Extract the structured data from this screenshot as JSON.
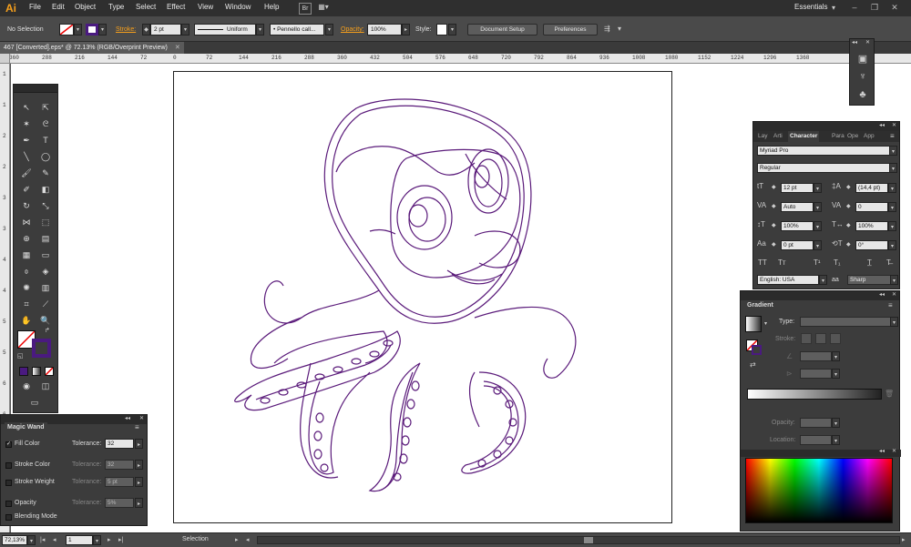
{
  "app": {
    "logo": "Ai",
    "workspace": "Essentials"
  },
  "menu": [
    "File",
    "Edit",
    "Object",
    "Type",
    "Select",
    "Effect",
    "View",
    "Window",
    "Help"
  ],
  "control_bar": {
    "selection": "No Selection",
    "stroke_label": "Stroke:",
    "stroke_weight": "2 pt",
    "profile": "Uniform",
    "brush": "Pennello call...",
    "opacity_label": "Opacity:",
    "opacity": "100%",
    "style_label": "Style:",
    "document_setup": "Document Setup",
    "preferences": "Preferences"
  },
  "document": {
    "tab": "467 [Converted].eps* @ 72.13% (RGB/Overprint Preview)"
  },
  "ruler": {
    "h_ticks": [
      "360",
      "288",
      "216",
      "144",
      "72",
      "0",
      "72",
      "144",
      "216",
      "288",
      "360",
      "432",
      "504",
      "576",
      "648",
      "720",
      "792",
      "864",
      "936",
      "1008",
      "1080",
      "1152",
      "1224",
      "1296",
      "1368"
    ],
    "v_ticks": [
      "1",
      "1",
      "2",
      "2",
      "3",
      "3",
      "4",
      "4",
      "5",
      "5",
      "6",
      "6",
      "7",
      "7",
      "8"
    ]
  },
  "magic_wand": {
    "title": "Magic Wand",
    "rows": [
      {
        "label": "Fill Color",
        "checked": true,
        "tol_label": "Tolerance:",
        "value": "32",
        "enabled": true
      },
      {
        "label": "Stroke Color",
        "checked": false,
        "tol_label": "Tolerance:",
        "value": "32",
        "enabled": false
      },
      {
        "label": "Stroke Weight",
        "checked": false,
        "tol_label": "Tolerance:",
        "value": "5 pt",
        "enabled": false
      },
      {
        "label": "Opacity",
        "checked": false,
        "tol_label": "Tolerance:",
        "value": "5%",
        "enabled": false
      },
      {
        "label": "Blending Mode",
        "checked": false,
        "tol_label": "",
        "value": "",
        "enabled": false
      }
    ]
  },
  "character": {
    "tabs": [
      "Lay",
      "Arti",
      "Character",
      "Para",
      "Ope",
      "App"
    ],
    "active_tab": "Character",
    "font": "Myriad Pro",
    "style": "Regular",
    "size": "12 pt",
    "leading": "(14,4 pt)",
    "kerning": "Auto",
    "tracking": "0",
    "v_scale": "100%",
    "h_scale": "100%",
    "baseline": "0 pt",
    "rotation": "0°",
    "language": "English: USA",
    "antialias": "Sharp",
    "aa_icon": "aa"
  },
  "gradient": {
    "title": "Gradient",
    "type_label": "Type:",
    "stroke_label": "Stroke:",
    "opacity_label": "Opacity:",
    "location_label": "Location:"
  },
  "status": {
    "zoom": "72,13%",
    "page": "1",
    "tool": "Selection"
  },
  "colors": {
    "artwork_stroke": "#5a1a7a",
    "accent": "#f7a01c",
    "stroke_swatch": "#4a1a80"
  }
}
